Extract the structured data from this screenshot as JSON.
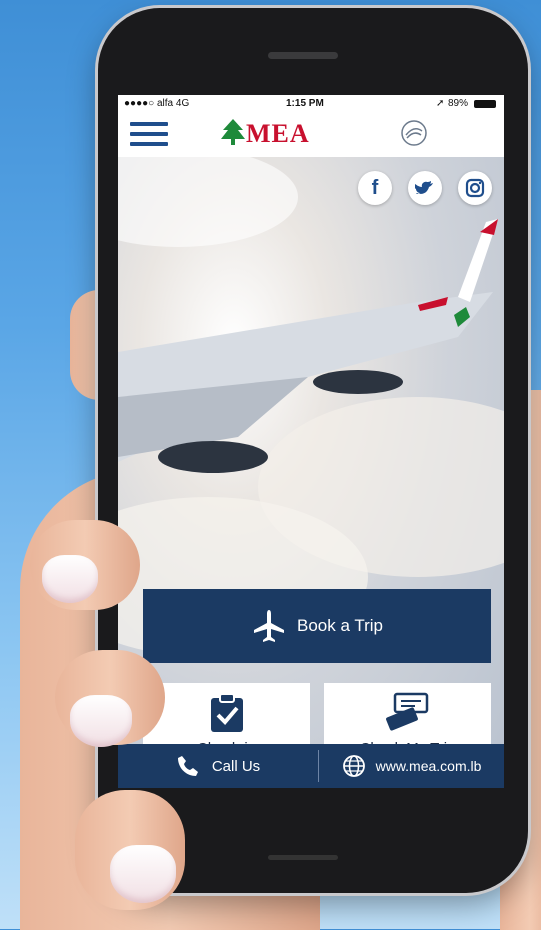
{
  "status": {
    "carrier": "●●●●○ alfa  4G",
    "time": "1:15 PM",
    "battery": "89%"
  },
  "header": {
    "logo_text": "MEA",
    "skyteam_label": "SKYTEAM"
  },
  "social": [
    {
      "name": "facebook",
      "glyph": "f"
    },
    {
      "name": "twitter",
      "glyph": "t"
    },
    {
      "name": "instagram",
      "glyph": "ig"
    }
  ],
  "actions": {
    "book_trip": "Book a Trip",
    "check_in": "Check-in",
    "check_my_trip": "Check My Trip"
  },
  "footer": {
    "call_us": "Call Us",
    "website": "www.mea.com.lb"
  },
  "colors": {
    "navy": "#1b3a63",
    "brand_blue": "#1f4e8c",
    "brand_red": "#c8102e",
    "cedar_green": "#1e8a3a"
  }
}
